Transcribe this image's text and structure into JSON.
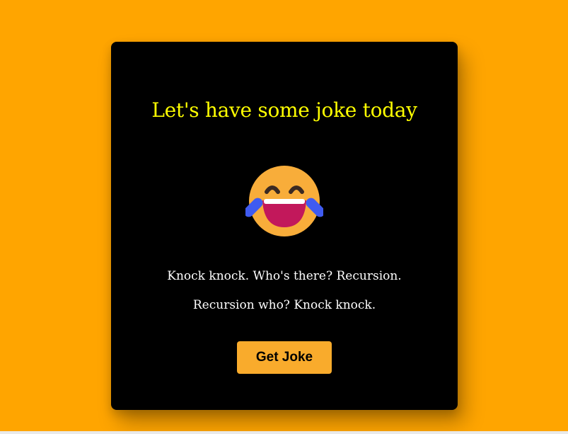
{
  "page": {
    "background_color": "#ffa500"
  },
  "card": {
    "title": "Let's have some joke today",
    "emoji": "face-with-tears-of-joy-icon",
    "joke": "Knock knock. Who's there? Recursion. Recursion who? Knock knock.",
    "button_label": "Get Joke",
    "title_color": "#ffff00",
    "button_color": "#f9ab2c",
    "background_color": "#000000"
  }
}
